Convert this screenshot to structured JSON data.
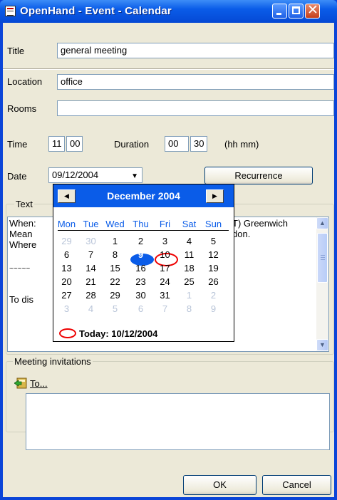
{
  "window": {
    "title": "OpenHand - Event - Calendar"
  },
  "form": {
    "title_label": "Title",
    "title_value": "general meeting",
    "location_label": "Location",
    "location_value": "office",
    "rooms_label": "Rooms",
    "rooms_value": "",
    "time_label": "Time",
    "time_hh": "11",
    "time_mm": "00",
    "duration_label": "Duration",
    "duration_hh": "00",
    "duration_mm": "30",
    "duration_hint": "(hh mm)",
    "date_label": "Date",
    "date_value": "09/12/2004",
    "recurrence_label": "Recurrence"
  },
  "text_group": {
    "label": "Text",
    "lines": [
      "When:",
      "Mean",
      "Where",
      "~~~~~",
      "",
      "To dis"
    ],
    "right_lines": [
      "T) Greenwich",
      "don."
    ]
  },
  "calendar": {
    "month_label": "December 2004",
    "days_of_week": [
      "Mon",
      "Tue",
      "Wed",
      "Thu",
      "Fri",
      "Sat",
      "Sun"
    ],
    "weeks": [
      [
        "29",
        "30",
        "1",
        "2",
        "3",
        "4",
        "5"
      ],
      [
        "6",
        "7",
        "8",
        "9",
        "10",
        "11",
        "12"
      ],
      [
        "13",
        "14",
        "15",
        "16",
        "17",
        "18",
        "19"
      ],
      [
        "20",
        "21",
        "22",
        "23",
        "24",
        "25",
        "26"
      ],
      [
        "27",
        "28",
        "29",
        "30",
        "31",
        "1",
        "2"
      ],
      [
        "3",
        "4",
        "5",
        "6",
        "7",
        "8",
        "9"
      ]
    ],
    "dim_cells": [
      [
        0,
        0
      ],
      [
        0,
        1
      ],
      [
        4,
        5
      ],
      [
        4,
        6
      ],
      [
        5,
        0
      ],
      [
        5,
        1
      ],
      [
        5,
        2
      ],
      [
        5,
        3
      ],
      [
        5,
        4
      ],
      [
        5,
        5
      ],
      [
        5,
        6
      ]
    ],
    "selected": "9",
    "today_day": "10",
    "today_label": "Today: 10/12/2004",
    "colors": {
      "header": "#0a5ce8",
      "today_ring": "#e00000",
      "dim": "#b8c4d8"
    }
  },
  "invitations": {
    "label": "Meeting invitations",
    "to_label": "To..."
  },
  "buttons": {
    "ok": "OK",
    "cancel": "Cancel"
  }
}
